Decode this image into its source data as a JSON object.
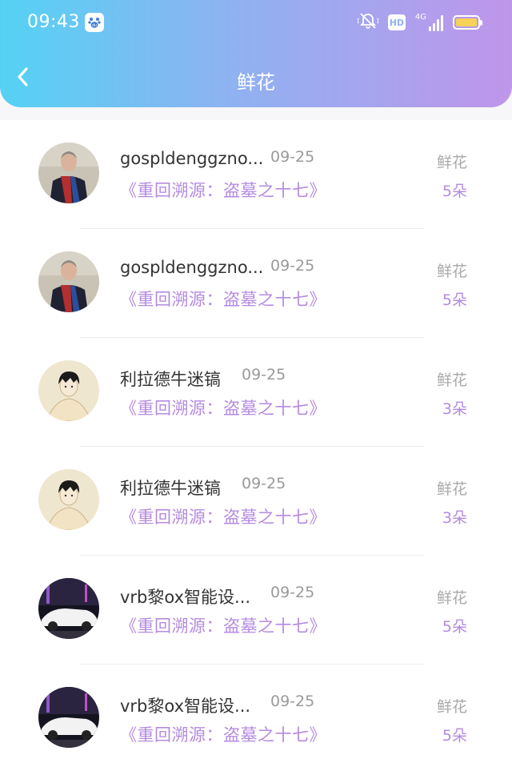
{
  "status_bar": {
    "time": "09:43",
    "baidu_icon": "baidu-paw-icon",
    "mute_icon": "bell-off-icon",
    "hd_label": "HD",
    "network_label": "4G",
    "battery_color": "#f6d257"
  },
  "header": {
    "title": "鲜花",
    "back_icon": "chevron-left-icon",
    "gradient": [
      "#54d2f4",
      "#bf95ea"
    ]
  },
  "records": [
    {
      "user": "gospldenggzno...",
      "date": "09-25",
      "work": "《重回溯源：盗墓之十七》",
      "gift": "鲜花",
      "count": "5朵",
      "avatar": "man-with-scarf"
    },
    {
      "user": "gospldenggzno...",
      "date": "09-25",
      "work": "《重回溯源：盗墓之十七》",
      "gift": "鲜花",
      "count": "5朵",
      "avatar": "man-with-scarf"
    },
    {
      "user": "利拉德牛迷镐",
      "date": "09-25",
      "work": "《重回溯源：盗墓之十七》",
      "gift": "鲜花",
      "count": "3朵",
      "avatar": "anime-boy"
    },
    {
      "user": "利拉德牛迷镐",
      "date": "09-25",
      "work": "《重回溯源：盗墓之十七》",
      "gift": "鲜花",
      "count": "3朵",
      "avatar": "anime-boy"
    },
    {
      "user": "vrb黎ox智能设...",
      "date": "09-25",
      "work": "《重回溯源：盗墓之十七》",
      "gift": "鲜花",
      "count": "5朵",
      "avatar": "white-sports-car"
    },
    {
      "user": "vrb黎ox智能设...",
      "date": "09-25",
      "work": "《重回溯源：盗墓之十七》",
      "gift": "鲜花",
      "count": "5朵",
      "avatar": "white-sports-car"
    }
  ]
}
